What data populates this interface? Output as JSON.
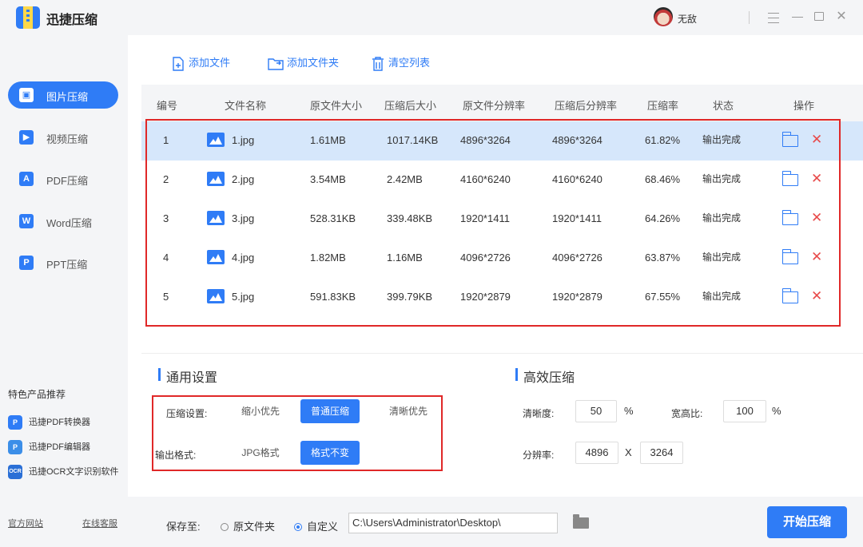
{
  "window": {
    "title": "迅捷压缩",
    "user_name": "无敌"
  },
  "sidebar": {
    "items": [
      {
        "label": "图片压缩",
        "icon": "image-icon",
        "icon_glyph": "▣",
        "active": true
      },
      {
        "label": "视频压缩",
        "icon": "video-icon",
        "icon_glyph": "▶",
        "active": false
      },
      {
        "label": "PDF压缩",
        "icon": "pdf-icon",
        "icon_glyph": "A",
        "active": false
      },
      {
        "label": "Word压缩",
        "icon": "word-icon",
        "icon_glyph": "W",
        "active": false
      },
      {
        "label": "PPT压缩",
        "icon": "ppt-icon",
        "icon_glyph": "P",
        "active": false
      }
    ],
    "promo_title": "特色产品推荐",
    "promos": [
      {
        "label": "迅捷PDF转换器",
        "icon": "pdf-converter-icon",
        "glyph": "P",
        "color": "#2f7cf6"
      },
      {
        "label": "迅捷PDF编辑器",
        "icon": "pdf-editor-icon",
        "glyph": "P",
        "color": "#3b8ee8"
      },
      {
        "label": "迅捷OCR文字识别软件",
        "icon": "ocr-icon",
        "glyph": "OCR",
        "color": "#2a6fd6"
      }
    ],
    "footer": {
      "website": "官方网站",
      "support": "在线客服"
    }
  },
  "toolbar": {
    "add_file": "添加文件",
    "add_folder": "添加文件夹",
    "clear_list": "清空列表"
  },
  "table": {
    "headers": [
      "编号",
      "文件名称",
      "原文件大小",
      "压缩后大小",
      "原文件分辨率",
      "压缩后分辨率",
      "压缩率",
      "状态",
      "操作"
    ],
    "rows": [
      {
        "no": "1",
        "name": "1.jpg",
        "orig_size": "1.61MB",
        "comp_size": "1017.14KB",
        "orig_res": "4896*3264",
        "comp_res": "4896*3264",
        "rate": "61.82%",
        "status": "输出完成",
        "selected": true
      },
      {
        "no": "2",
        "name": "2.jpg",
        "orig_size": "3.54MB",
        "comp_size": "2.42MB",
        "orig_res": "4160*6240",
        "comp_res": "4160*6240",
        "rate": "68.46%",
        "status": "输出完成",
        "selected": false
      },
      {
        "no": "3",
        "name": "3.jpg",
        "orig_size": "528.31KB",
        "comp_size": "339.48KB",
        "orig_res": "1920*1411",
        "comp_res": "1920*1411",
        "rate": "64.26%",
        "status": "输出完成",
        "selected": false
      },
      {
        "no": "4",
        "name": "4.jpg",
        "orig_size": "1.82MB",
        "comp_size": "1.16MB",
        "orig_res": "4096*2726",
        "comp_res": "4096*2726",
        "rate": "63.87%",
        "status": "输出完成",
        "selected": false
      },
      {
        "no": "5",
        "name": "5.jpg",
        "orig_size": "591.83KB",
        "comp_size": "399.79KB",
        "orig_res": "1920*2879",
        "comp_res": "1920*2879",
        "rate": "67.55%",
        "status": "输出完成",
        "selected": false
      }
    ]
  },
  "general_settings": {
    "title": "通用设置",
    "compress_label": "压缩设置:",
    "compress_options": [
      "缩小优先",
      "普通压缩",
      "清晰优先"
    ],
    "compress_selected": "普通压缩",
    "format_label": "输出格式:",
    "format_options": [
      "JPG格式",
      "格式不变"
    ],
    "format_selected": "格式不变"
  },
  "efficient_settings": {
    "title": "高效压缩",
    "clarity_label": "清晰度:",
    "clarity_value": "50",
    "clarity_unit": "%",
    "aspect_label": "宽高比:",
    "aspect_value": "100",
    "aspect_unit": "%",
    "resolution_label": "分辨率:",
    "res_width": "4896",
    "res_sep": "X",
    "res_height": "3264"
  },
  "bottom_bar": {
    "save_label": "保存至:",
    "option_original": "原文件夹",
    "option_custom": "自定义",
    "custom_selected": true,
    "path": "C:\\Users\\Administrator\\Desktop\\",
    "start_label": "开始压缩"
  },
  "colors": {
    "accent": "#2f7cf6",
    "highlight_row": "#d6e7fb",
    "danger": "#e84a4a",
    "annotation_box": "#e02828"
  }
}
